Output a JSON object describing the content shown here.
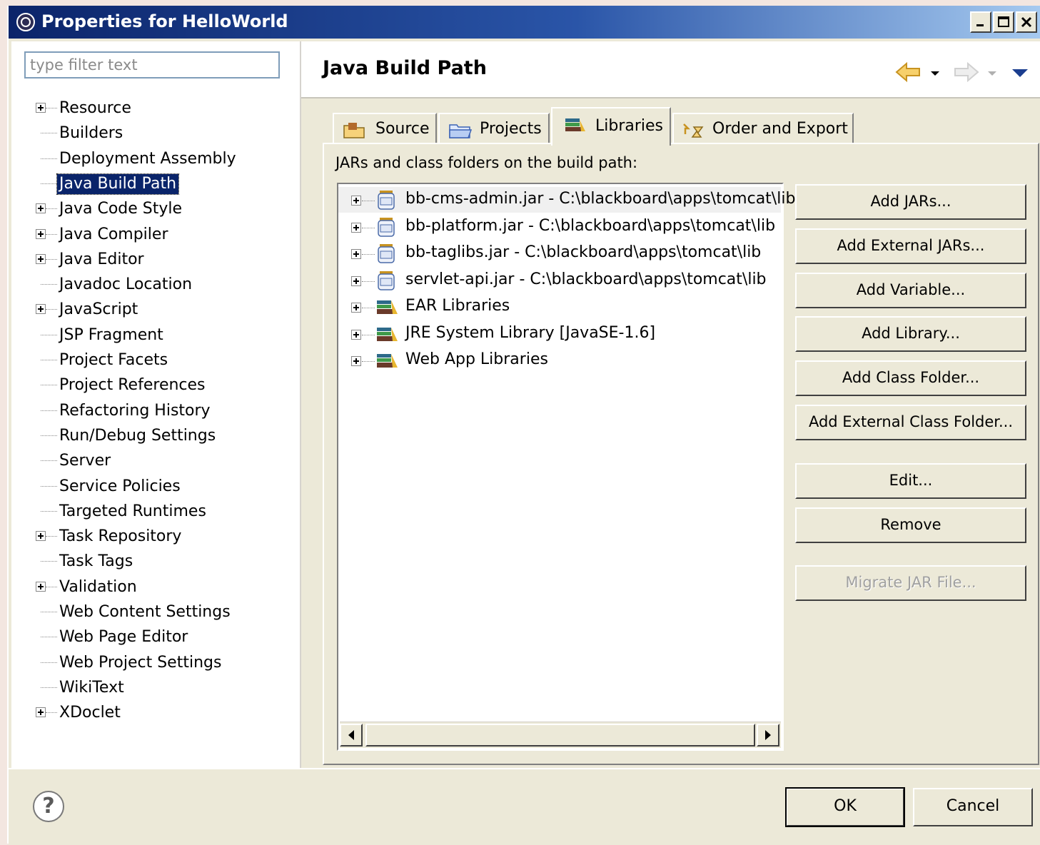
{
  "window": {
    "title": "Properties for HelloWorld"
  },
  "filter": {
    "placeholder": "type filter text"
  },
  "tree": [
    {
      "label": "Resource",
      "expandable": true
    },
    {
      "label": "Builders",
      "expandable": false
    },
    {
      "label": "Deployment Assembly",
      "expandable": false
    },
    {
      "label": "Java Build Path",
      "expandable": false,
      "selected": true
    },
    {
      "label": "Java Code Style",
      "expandable": true
    },
    {
      "label": "Java Compiler",
      "expandable": true
    },
    {
      "label": "Java Editor",
      "expandable": true
    },
    {
      "label": "Javadoc Location",
      "expandable": false
    },
    {
      "label": "JavaScript",
      "expandable": true
    },
    {
      "label": "JSP Fragment",
      "expandable": false
    },
    {
      "label": "Project Facets",
      "expandable": false
    },
    {
      "label": "Project References",
      "expandable": false
    },
    {
      "label": "Refactoring History",
      "expandable": false
    },
    {
      "label": "Run/Debug Settings",
      "expandable": false
    },
    {
      "label": "Server",
      "expandable": false
    },
    {
      "label": "Service Policies",
      "expandable": false
    },
    {
      "label": "Targeted Runtimes",
      "expandable": false
    },
    {
      "label": "Task Repository",
      "expandable": true
    },
    {
      "label": "Task Tags",
      "expandable": false
    },
    {
      "label": "Validation",
      "expandable": true
    },
    {
      "label": "Web Content Settings",
      "expandable": false
    },
    {
      "label": "Web Page Editor",
      "expandable": false
    },
    {
      "label": "Web Project Settings",
      "expandable": false
    },
    {
      "label": "WikiText",
      "expandable": false
    },
    {
      "label": "XDoclet",
      "expandable": true
    }
  ],
  "page": {
    "title": "Java Build Path"
  },
  "tabs": [
    {
      "label": "Source",
      "icon": "source-folder-icon"
    },
    {
      "label": "Projects",
      "icon": "projects-folder-icon"
    },
    {
      "label": "Libraries",
      "icon": "libraries-icon",
      "active": true
    },
    {
      "label": "Order and Export",
      "icon": "order-export-icon"
    }
  ],
  "panel": {
    "label": "JARs and class folders on the build path:"
  },
  "entries": [
    {
      "label": "bb-cms-admin.jar - C:\\blackboard\\apps\\tomcat\\lib",
      "icon": "jar-icon",
      "selected": true
    },
    {
      "label": "bb-platform.jar - C:\\blackboard\\apps\\tomcat\\lib",
      "icon": "jar-icon"
    },
    {
      "label": "bb-taglibs.jar - C:\\blackboard\\apps\\tomcat\\lib",
      "icon": "jar-icon"
    },
    {
      "label": "servlet-api.jar - C:\\blackboard\\apps\\tomcat\\lib",
      "icon": "jar-icon"
    },
    {
      "label": "EAR Libraries",
      "icon": "library-icon"
    },
    {
      "label": "JRE System Library [JavaSE-1.6]",
      "icon": "library-icon"
    },
    {
      "label": "Web App Libraries",
      "icon": "library-icon"
    }
  ],
  "buttons": {
    "add_jars": "Add JARs...",
    "add_external_jars": "Add External JARs...",
    "add_variable": "Add Variable...",
    "add_library": "Add Library...",
    "add_class_folder": "Add Class Folder...",
    "add_external_class_folder": "Add External Class Folder...",
    "edit": "Edit...",
    "remove": "Remove",
    "migrate_jar": "Migrate JAR File..."
  },
  "footer": {
    "help": "?",
    "ok": "OK",
    "cancel": "Cancel"
  },
  "colors": {
    "title_bar": "#0b246a",
    "selection": "#0a246a",
    "dialog_bg": "#ece9d8"
  }
}
